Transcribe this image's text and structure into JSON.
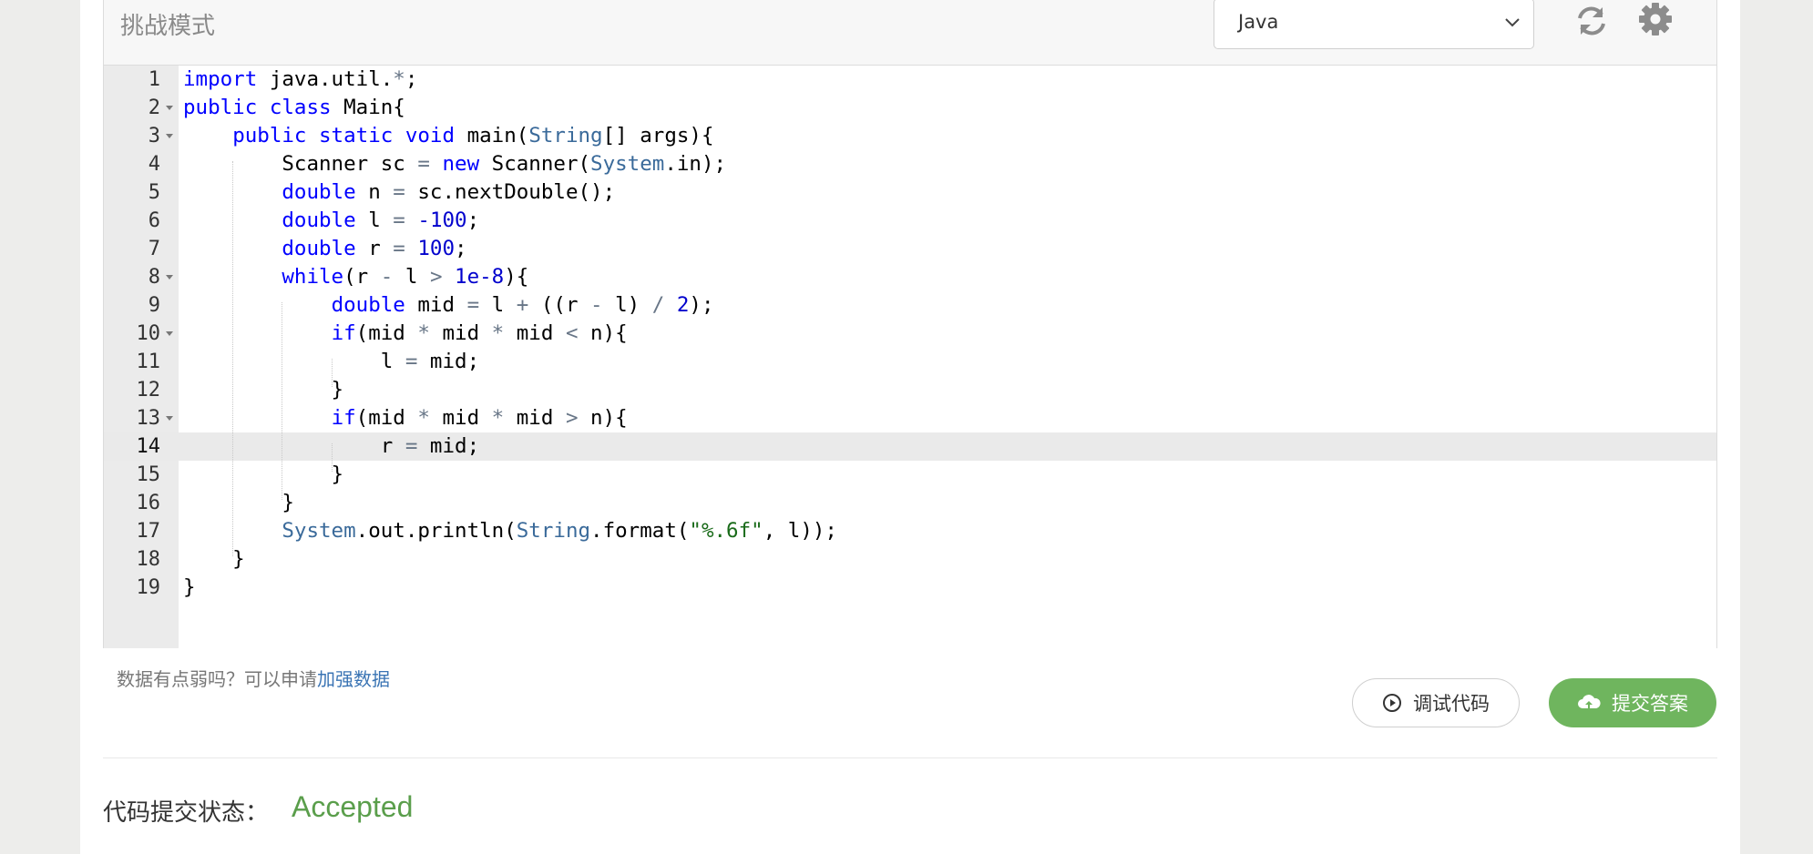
{
  "toolbar": {
    "mode_label": "挑战模式",
    "language_select": {
      "selected": "Java"
    },
    "refresh_icon": "refresh-icon",
    "settings_icon": "gear-icon"
  },
  "editor": {
    "active_line": 14,
    "line_numbers": [
      "1",
      "2",
      "3",
      "4",
      "5",
      "6",
      "7",
      "8",
      "9",
      "10",
      "11",
      "12",
      "13",
      "14",
      "15",
      "16",
      "17",
      "18",
      "19"
    ],
    "lines": [
      "import java.util.*;",
      "public class Main{",
      "    public static void main(String[] args){",
      "        Scanner sc = new Scanner(System.in);",
      "        double n = sc.nextDouble();",
      "        double l = -100;",
      "        double r = 100;",
      "        while(r - l > 1e-8){",
      "            double mid = l + ((r - l) / 2);",
      "            if(mid * mid * mid < n){",
      "                l = mid;",
      "            }",
      "            if(mid * mid * mid > n){",
      "                r = mid;",
      "            }",
      "        }",
      "        System.out.println(String.format(\"%.6f\", l));",
      "    }",
      "}"
    ]
  },
  "hint": {
    "text": "数据有点弱吗？可以申请",
    "link": "加强数据"
  },
  "buttons": {
    "debug_label": "调试代码",
    "submit_label": "提交答案"
  },
  "status": {
    "label": "代码提交状态：",
    "value": "Accepted"
  },
  "colors": {
    "accent_green": "#6fb55e",
    "accepted_green": "#5a9e4b",
    "link_blue": "#3a74b4"
  }
}
